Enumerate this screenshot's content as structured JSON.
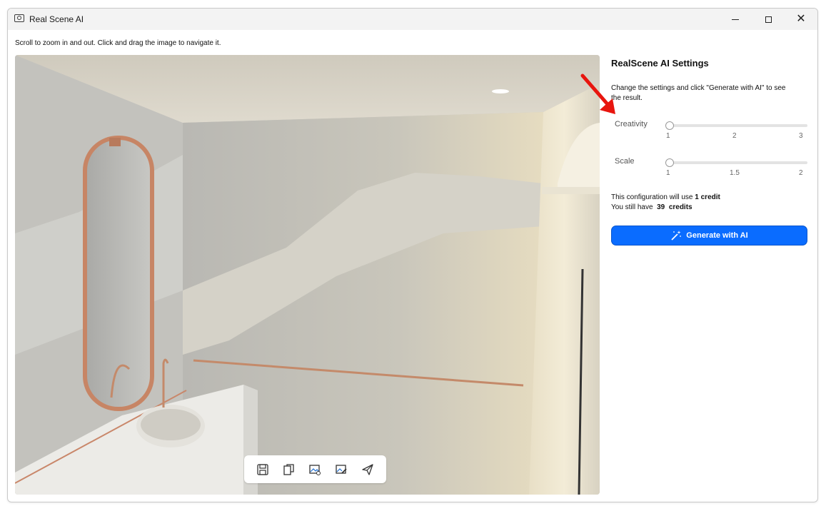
{
  "window": {
    "title": "Real Scene AI"
  },
  "titlebar": {
    "icon": "camera-icon",
    "minimize": "minimize",
    "maximize": "maximize",
    "close": "✕"
  },
  "instructions": "Scroll to zoom in and out. Click and drag the image to navigate it.",
  "toolbar": {
    "items": [
      {
        "icon": "save-icon"
      },
      {
        "icon": "copy-icon"
      },
      {
        "icon": "image-settings-icon"
      },
      {
        "icon": "image-edit-icon"
      },
      {
        "icon": "send-icon"
      }
    ]
  },
  "settings": {
    "title": "RealScene AI Settings",
    "description": "Change the settings and click \"Generate with AI\" to see the result.",
    "creativity": {
      "label": "Creativity",
      "ticks": [
        "1",
        "2",
        "3"
      ],
      "value": 1,
      "min": 1,
      "max": 3
    },
    "scale": {
      "label": "Scale",
      "ticks": [
        "1",
        "1.5",
        "2"
      ],
      "value": 1,
      "min": 1,
      "max": 2
    },
    "usage_line1_prefix": "This configuration will use",
    "usage_line1_value": "1 credit",
    "usage_line2_prefix": "You still have",
    "usage_line2_count": "39",
    "usage_line2_suffix": "credits",
    "generate_label": "Generate with AI",
    "generate_icon": "magic-wand-icon"
  },
  "colors": {
    "accent": "#0a6cff",
    "annotation": "#e8150e"
  }
}
